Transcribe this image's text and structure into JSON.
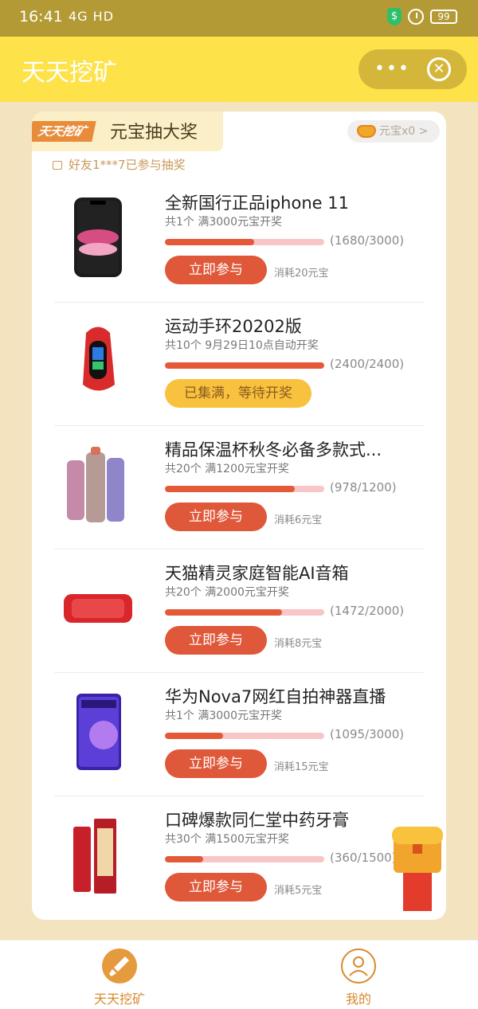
{
  "status_bar": {
    "time": "16:41",
    "network": "4G HD",
    "battery": "99"
  },
  "header": {
    "title": "天天挖矿"
  },
  "card": {
    "brand": "天天挖矿",
    "title": "元宝抽大奖",
    "yuanbao_balance": "元宝x0 >",
    "friend_notice": "好友1***7已参与抽奖"
  },
  "items": [
    {
      "name": "全新国行正品iphone 11",
      "desc": "共1个  满3000元宝开奖",
      "progress": 0.56,
      "count": "(1680/3000)",
      "button": "立即参与",
      "cost": "消耗20元宝",
      "state": "active"
    },
    {
      "name": "运动手环20202版",
      "desc": "共10个  9月29日10点自动开奖",
      "progress": 1.0,
      "count": "(2400/2400)",
      "button": "已集满，等待开奖",
      "cost": "",
      "state": "full"
    },
    {
      "name": "精品保温杯秋冬必备多款式...",
      "desc": "共20个  满1200元宝开奖",
      "progress": 0.815,
      "count": "(978/1200)",
      "button": "立即参与",
      "cost": "消耗6元宝",
      "state": "active"
    },
    {
      "name": "天猫精灵家庭智能AI音箱",
      "desc": "共20个  满2000元宝开奖",
      "progress": 0.736,
      "count": "(1472/2000)",
      "button": "立即参与",
      "cost": "消耗8元宝",
      "state": "active"
    },
    {
      "name": "华为Nova7网红自拍神器直播",
      "desc": "共1个  满3000元宝开奖",
      "progress": 0.365,
      "count": "(1095/3000)",
      "button": "立即参与",
      "cost": "消耗15元宝",
      "state": "active"
    },
    {
      "name": "口碑爆款同仁堂中药牙膏",
      "desc": "共30个  满1500元宝开奖",
      "progress": 0.24,
      "count": "(360/1500)",
      "button": "立即参与",
      "cost": "消耗5元宝",
      "state": "active"
    }
  ],
  "tabbar": {
    "tab1": "天天挖矿",
    "tab2": "我的"
  },
  "colors": {
    "accent": "#e0583a",
    "header": "#fde24a",
    "tab": "#d88a2c"
  }
}
